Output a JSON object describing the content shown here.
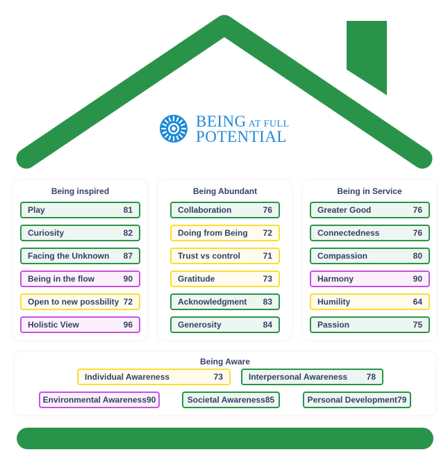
{
  "brand": {
    "line1": "BEING",
    "line1_small": "AT FULL",
    "line2": "POTENTIAL",
    "logo_icon": "sunburst-icon",
    "color": "#1c8ad6"
  },
  "colors": {
    "house_green": "#2a934a",
    "status_green": "#2a934a",
    "status_yellow": "#fadd35",
    "status_purple": "#c552df",
    "text": "#334166"
  },
  "columns": [
    {
      "title": "Being inspired",
      "items": [
        {
          "label": "Play",
          "value": "81",
          "status": "green"
        },
        {
          "label": "Curiosity",
          "value": "82",
          "status": "green"
        },
        {
          "label": "Facing the Unknown",
          "value": "87",
          "status": "green"
        },
        {
          "label": "Being in the flow",
          "value": "90",
          "status": "purple"
        },
        {
          "label": "Open to new possbility",
          "value": "72",
          "status": "yellow"
        },
        {
          "label": "Holistic View",
          "value": "96",
          "status": "purple"
        }
      ]
    },
    {
      "title": "Being Abundant",
      "items": [
        {
          "label": "Collaboration",
          "value": "76",
          "status": "green"
        },
        {
          "label": "Doing from Being",
          "value": "72",
          "status": "yellow"
        },
        {
          "label": "Trust vs control",
          "value": "71",
          "status": "yellow"
        },
        {
          "label": "Gratitude",
          "value": "73",
          "status": "yellow"
        },
        {
          "label": "Acknowledgment",
          "value": "83",
          "status": "green"
        },
        {
          "label": "Generosity",
          "value": "84",
          "status": "green"
        }
      ]
    },
    {
      "title": "Being in Service",
      "items": [
        {
          "label": "Greater Good",
          "value": "76",
          "status": "green"
        },
        {
          "label": "Connectedness",
          "value": "76",
          "status": "green"
        },
        {
          "label": "Compassion",
          "value": "80",
          "status": "green"
        },
        {
          "label": "Harmony",
          "value": "90",
          "status": "purple"
        },
        {
          "label": "Humility",
          "value": "64",
          "status": "yellow"
        },
        {
          "label": "Passion",
          "value": "75",
          "status": "green"
        }
      ]
    }
  ],
  "aware": {
    "title": "Being Aware",
    "items": [
      {
        "label": "Individual Awareness",
        "value": "73",
        "status": "yellow"
      },
      {
        "label": "Interpersonal Awareness",
        "value": "78",
        "status": "green"
      },
      {
        "label": "Environmental Awareness",
        "value": "90",
        "status": "purple"
      },
      {
        "label": "Societal Awareness",
        "value": "85",
        "status": "green"
      },
      {
        "label": "Personal Development",
        "value": "79",
        "status": "green"
      }
    ]
  }
}
